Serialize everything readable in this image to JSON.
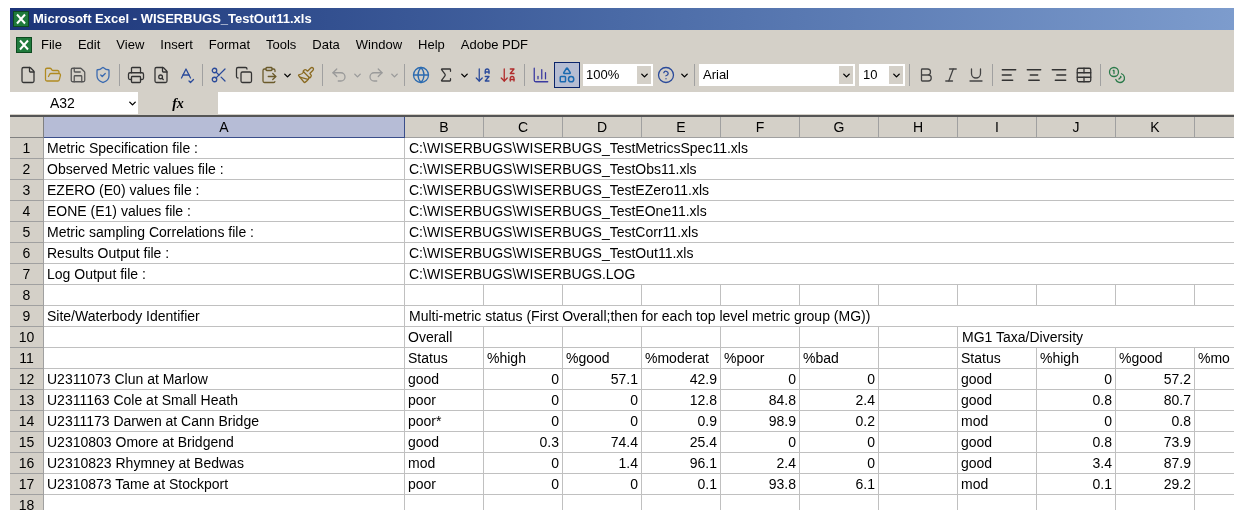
{
  "window": {
    "title": "Microsoft Excel - WISERBUGS_TestOut11.xls"
  },
  "menu": [
    "File",
    "Edit",
    "View",
    "Insert",
    "Format",
    "Tools",
    "Data",
    "Window",
    "Help",
    "Adobe PDF"
  ],
  "toolbar": {
    "zoom": "100%",
    "font": "Arial",
    "font_size": "10",
    "drawing_selected": true
  },
  "formula_bar": {
    "name_box": "A32",
    "function_label": "fx"
  },
  "columns": [
    {
      "label": "A",
      "selected": true
    },
    {
      "label": "B",
      "selected": false
    },
    {
      "label": "C",
      "selected": false
    },
    {
      "label": "D",
      "selected": false
    },
    {
      "label": "E",
      "selected": false
    },
    {
      "label": "F",
      "selected": false
    },
    {
      "label": "G",
      "selected": false
    },
    {
      "label": "H",
      "selected": false
    },
    {
      "label": "I",
      "selected": false
    },
    {
      "label": "J",
      "selected": false
    },
    {
      "label": "K",
      "selected": false
    },
    {
      "selected": false
    }
  ],
  "rows": [
    {
      "number": "1",
      "cells": {
        "a": {
          "text": "Metric Specification file :"
        },
        "b": {
          "text": "C:\\WISERBUGS\\WISERBUGS_TestMetricsSpec11.xls",
          "spans": true
        }
      }
    },
    {
      "number": "2",
      "cells": {
        "a": {
          "text": "Observed Metric values file :"
        },
        "b": {
          "text": "C:\\WISERBUGS\\WISERBUGS_TestObs11.xls",
          "spans": true
        }
      }
    },
    {
      "number": "3",
      "cells": {
        "a": {
          "text": "EZERO (E0) values file :"
        },
        "b": {
          "text": "C:\\WISERBUGS\\WISERBUGS_TestEZero11.xls",
          "spans": true
        }
      }
    },
    {
      "number": "4",
      "cells": {
        "a": {
          "text": "EONE (E1) values file :"
        },
        "b": {
          "text": "C:\\WISERBUGS\\WISERBUGS_TestEOne11.xls",
          "spans": true
        }
      }
    },
    {
      "number": "5",
      "cells": {
        "a": {
          "text": "Metric sampling Correlations file :"
        },
        "b": {
          "text": "C:\\WISERBUGS\\WISERBUGS_TestCorr11.xls",
          "spans": true
        }
      }
    },
    {
      "number": "6",
      "cells": {
        "a": {
          "text": "Results Output file :"
        },
        "b": {
          "text": "C:\\WISERBUGS\\WISERBUGS_TestOut11.xls",
          "spans": true
        }
      }
    },
    {
      "number": "7",
      "cells": {
        "a": {
          "text": "Log Output file :"
        },
        "b": {
          "text": "C:\\WISERBUGS\\WISERBUGS.LOG",
          "spans": true
        }
      }
    },
    {
      "number": "8",
      "cells": {}
    },
    {
      "number": "9",
      "cells": {
        "a": {
          "text": "Site/Waterbody Identifier"
        },
        "b": {
          "text": "Multi-metric status (First Overall;then for each top level metric group (MG))",
          "spans": true
        }
      }
    },
    {
      "number": "10",
      "cells": {
        "b": {
          "text": "Overall"
        },
        "i": {
          "text": "MG1 Taxa/Diversity",
          "spans": true
        }
      }
    },
    {
      "number": "11",
      "cells": {
        "b": {
          "text": "Status"
        },
        "c": {
          "text": "%high"
        },
        "d": {
          "text": "%good"
        },
        "e": {
          "text": "%moderat"
        },
        "f": {
          "text": "%poor"
        },
        "g": {
          "text": "%bad"
        },
        "i": {
          "text": "Status"
        },
        "j": {
          "text": "%high"
        },
        "k": {
          "text": "%good"
        },
        "l": {
          "text": "%mo"
        }
      }
    },
    {
      "number": "12",
      "cells": {
        "a": {
          "text": "U2311073 Clun at Marlow"
        },
        "b": {
          "text": "good"
        },
        "c": {
          "text": "0",
          "right_aligned": true
        },
        "d": {
          "text": "57.1",
          "right_aligned": true
        },
        "e": {
          "text": "42.9",
          "right_aligned": true
        },
        "f": {
          "text": "0",
          "right_aligned": true
        },
        "g": {
          "text": "0",
          "right_aligned": true
        },
        "i": {
          "text": "good"
        },
        "j": {
          "text": "0",
          "right_aligned": true
        },
        "k": {
          "text": "57.2",
          "right_aligned": true
        }
      }
    },
    {
      "number": "13",
      "cells": {
        "a": {
          "text": "U2311163 Cole at Small Heath"
        },
        "b": {
          "text": "poor"
        },
        "c": {
          "text": "0",
          "right_aligned": true
        },
        "d": {
          "text": "0",
          "right_aligned": true
        },
        "e": {
          "text": "12.8",
          "right_aligned": true
        },
        "f": {
          "text": "84.8",
          "right_aligned": true
        },
        "g": {
          "text": "2.4",
          "right_aligned": true
        },
        "i": {
          "text": "good"
        },
        "j": {
          "text": "0.8",
          "right_aligned": true
        },
        "k": {
          "text": "80.7",
          "right_aligned": true
        }
      }
    },
    {
      "number": "14",
      "cells": {
        "a": {
          "text": "U2311173 Darwen at Cann Bridge"
        },
        "b": {
          "text": "poor*"
        },
        "c": {
          "text": "0",
          "right_aligned": true
        },
        "d": {
          "text": "0",
          "right_aligned": true
        },
        "e": {
          "text": "0.9",
          "right_aligned": true
        },
        "f": {
          "text": "98.9",
          "right_aligned": true
        },
        "g": {
          "text": "0.2",
          "right_aligned": true
        },
        "i": {
          "text": "mod"
        },
        "j": {
          "text": "0",
          "right_aligned": true
        },
        "k": {
          "text": "0.8",
          "right_aligned": true
        }
      }
    },
    {
      "number": "15",
      "cells": {
        "a": {
          "text": "U2310803 Omore at Bridgend"
        },
        "b": {
          "text": "good"
        },
        "c": {
          "text": "0.3",
          "right_aligned": true
        },
        "d": {
          "text": "74.4",
          "right_aligned": true
        },
        "e": {
          "text": "25.4",
          "right_aligned": true
        },
        "f": {
          "text": "0",
          "right_aligned": true
        },
        "g": {
          "text": "0",
          "right_aligned": true
        },
        "i": {
          "text": "good"
        },
        "j": {
          "text": "0.8",
          "right_aligned": true
        },
        "k": {
          "text": "73.9",
          "right_aligned": true
        }
      }
    },
    {
      "number": "16",
      "cells": {
        "a": {
          "text": "U2310823 Rhymney at Bedwas"
        },
        "b": {
          "text": "mod"
        },
        "c": {
          "text": "0",
          "right_aligned": true
        },
        "d": {
          "text": "1.4",
          "right_aligned": true
        },
        "e": {
          "text": "96.1",
          "right_aligned": true
        },
        "f": {
          "text": "2.4",
          "right_aligned": true
        },
        "g": {
          "text": "0",
          "right_aligned": true
        },
        "i": {
          "text": "good"
        },
        "j": {
          "text": "3.4",
          "right_aligned": true
        },
        "k": {
          "text": "87.9",
          "right_aligned": true
        }
      }
    },
    {
      "number": "17",
      "cells": {
        "a": {
          "text": "U2310873 Tame at Stockport"
        },
        "b": {
          "text": "poor"
        },
        "c": {
          "text": "0",
          "right_aligned": true
        },
        "d": {
          "text": "0",
          "right_aligned": true
        },
        "e": {
          "text": "0.1",
          "right_aligned": true
        },
        "f": {
          "text": "93.8",
          "right_aligned": true
        },
        "g": {
          "text": "6.1",
          "right_aligned": true
        },
        "i": {
          "text": "mod"
        },
        "j": {
          "text": "0.1",
          "right_aligned": true
        },
        "k": {
          "text": "29.2",
          "right_aligned": true
        }
      }
    },
    {
      "number": "18",
      "cells": {}
    }
  ]
}
